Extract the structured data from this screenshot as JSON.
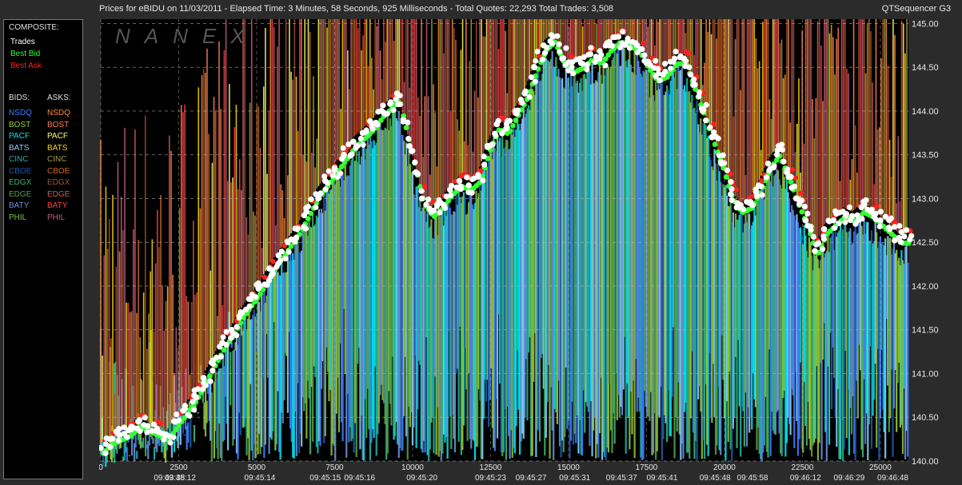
{
  "header": {
    "title": "Prices for  eBIDU  on  11/03/2011  -  Elapsed Time: 3 Minutes, 58 Seconds, 925 Milliseconds  -  Total Quotes: 22,293  Total Trades: 3,508",
    "app_name": "QTSequencer G3"
  },
  "watermark": "NANEX",
  "legend": {
    "composite_label": "COMPOSITE:",
    "trades": "Trades",
    "best_bid": "Best Bid",
    "best_ask": "Best Ask",
    "bids_label": "BIDS:",
    "asks_label": "ASKS:",
    "exchanges": [
      {
        "name": "NSDQ",
        "bid_color": "#3f7fff",
        "ask_color": "#ff8c3a"
      },
      {
        "name": "BOST",
        "bid_color": "#9acd32",
        "ask_color": "#ff7f50"
      },
      {
        "name": "PACF",
        "bid_color": "#00e5ee",
        "ask_color": "#ffff66"
      },
      {
        "name": "BATS",
        "bid_color": "#87cefa",
        "ask_color": "#ffd700"
      },
      {
        "name": "CINC",
        "bid_color": "#20b2aa",
        "ask_color": "#a0a040"
      },
      {
        "name": "CBOE",
        "bid_color": "#1e5aa8",
        "ask_color": "#d2691e"
      },
      {
        "name": "EDGX",
        "bid_color": "#3cb371",
        "ask_color": "#a0522d"
      },
      {
        "name": "EDGE",
        "bid_color": "#56a04a",
        "ask_color": "#cd5c5c"
      },
      {
        "name": "BATY",
        "bid_color": "#6a8ed8",
        "ask_color": "#ff4040"
      },
      {
        "name": "PHIL",
        "bid_color": "#8fbc3f",
        "ask_color": "#c06080"
      }
    ],
    "colors": {
      "trades": "#ffffff",
      "best_bid": "#33ff33",
      "best_ask": "#ff2020"
    }
  },
  "chart_data": {
    "type": "scatter",
    "x_ticks": [
      "0",
      "2500",
      "5000",
      "7500",
      "10000",
      "12500",
      "15000",
      "17500",
      "20000",
      "22500",
      "25000"
    ],
    "x_tick_values": [
      0,
      2500,
      5000,
      7500,
      10000,
      12500,
      15000,
      17500,
      20000,
      22500,
      25000
    ],
    "time_labels": [
      {
        "x": 2200,
        "label": "09:43:38"
      },
      {
        "x": 2550,
        "label": "09:45:12"
      },
      {
        "x": 5100,
        "label": "09:45:14"
      },
      {
        "x": 7200,
        "label": "09:45:15"
      },
      {
        "x": 8300,
        "label": "09:45:16"
      },
      {
        "x": 10300,
        "label": "09:45:20"
      },
      {
        "x": 12500,
        "label": "09:45:23"
      },
      {
        "x": 13800,
        "label": "09:45:27"
      },
      {
        "x": 15200,
        "label": "09:45:31"
      },
      {
        "x": 16700,
        "label": "09:45:37"
      },
      {
        "x": 18000,
        "label": "09:45:41"
      },
      {
        "x": 19700,
        "label": "09:45:48"
      },
      {
        "x": 20900,
        "label": "09:45:58"
      },
      {
        "x": 22600,
        "label": "09:46:12"
      },
      {
        "x": 24000,
        "label": "09:46:29"
      },
      {
        "x": 25400,
        "label": "09:46:48"
      }
    ],
    "y_ticks": [
      "140.00",
      "140.50",
      "141.00",
      "141.50",
      "142.00",
      "142.50",
      "143.00",
      "143.50",
      "144.00",
      "144.50",
      "145.00"
    ],
    "xlim": [
      0,
      25900
    ],
    "ylim": [
      140.0,
      145.05
    ],
    "trades": [
      [
        0,
        140.15
      ],
      [
        300,
        140.25
      ],
      [
        600,
        140.3
      ],
      [
        900,
        140.35
      ],
      [
        1200,
        140.45
      ],
      [
        1500,
        140.4
      ],
      [
        1800,
        140.35
      ],
      [
        2100,
        140.3
      ],
      [
        2400,
        140.45
      ],
      [
        2700,
        140.6
      ],
      [
        3000,
        140.75
      ],
      [
        3300,
        140.95
      ],
      [
        3600,
        141.15
      ],
      [
        3900,
        141.35
      ],
      [
        4200,
        141.5
      ],
      [
        4500,
        141.7
      ],
      [
        4800,
        141.85
      ],
      [
        5100,
        142.0
      ],
      [
        5400,
        142.2
      ],
      [
        5700,
        142.35
      ],
      [
        6000,
        142.5
      ],
      [
        6300,
        142.65
      ],
      [
        6600,
        142.85
      ],
      [
        6900,
        143.05
      ],
      [
        7200,
        143.2
      ],
      [
        7500,
        143.35
      ],
      [
        7800,
        143.5
      ],
      [
        8100,
        143.65
      ],
      [
        8400,
        143.75
      ],
      [
        8700,
        143.85
      ],
      [
        9000,
        144.0
      ],
      [
        9300,
        144.1
      ],
      [
        9500,
        144.2
      ],
      [
        9700,
        143.9
      ],
      [
        9900,
        143.6
      ],
      [
        10100,
        143.3
      ],
      [
        10300,
        143.0
      ],
      [
        10600,
        142.85
      ],
      [
        10900,
        142.95
      ],
      [
        11200,
        143.1
      ],
      [
        11500,
        143.2
      ],
      [
        11800,
        143.15
      ],
      [
        12100,
        143.25
      ],
      [
        12400,
        143.6
      ],
      [
        12700,
        143.85
      ],
      [
        13000,
        143.8
      ],
      [
        13300,
        144.0
      ],
      [
        13600,
        144.2
      ],
      [
        13900,
        144.5
      ],
      [
        14200,
        144.75
      ],
      [
        14500,
        144.85
      ],
      [
        14800,
        144.6
      ],
      [
        15100,
        144.5
      ],
      [
        15400,
        144.55
      ],
      [
        15700,
        144.65
      ],
      [
        16000,
        144.6
      ],
      [
        16300,
        144.75
      ],
      [
        16600,
        144.85
      ],
      [
        16900,
        144.8
      ],
      [
        17200,
        144.75
      ],
      [
        17500,
        144.55
      ],
      [
        17800,
        144.4
      ],
      [
        18100,
        144.45
      ],
      [
        18400,
        144.6
      ],
      [
        18700,
        144.6
      ],
      [
        19000,
        144.3
      ],
      [
        19300,
        144.0
      ],
      [
        19600,
        143.7
      ],
      [
        19900,
        143.4
      ],
      [
        20200,
        143.05
      ],
      [
        20500,
        142.9
      ],
      [
        20800,
        142.95
      ],
      [
        21100,
        143.15
      ],
      [
        21400,
        143.4
      ],
      [
        21700,
        143.55
      ],
      [
        22000,
        143.3
      ],
      [
        22300,
        143.0
      ],
      [
        22600,
        142.75
      ],
      [
        22900,
        142.4
      ],
      [
        23200,
        142.65
      ],
      [
        23500,
        142.75
      ],
      [
        23800,
        142.85
      ],
      [
        24100,
        142.8
      ],
      [
        24400,
        142.9
      ],
      [
        24700,
        142.85
      ],
      [
        25000,
        142.75
      ],
      [
        25300,
        142.65
      ],
      [
        25600,
        142.55
      ]
    ]
  }
}
